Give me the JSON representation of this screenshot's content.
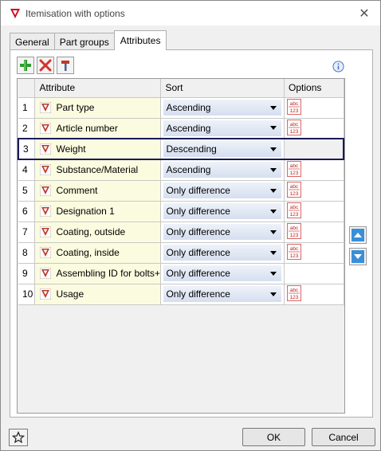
{
  "window": {
    "title": "Itemisation with options",
    "close_icon": "close-icon"
  },
  "tabs": [
    {
      "label": "General",
      "active": false
    },
    {
      "label": "Part groups",
      "active": false
    },
    {
      "label": "Attributes",
      "active": true
    }
  ],
  "toolbar": {
    "add_icon": "add-icon",
    "delete_icon": "delete-icon",
    "edit_icon": "hammer-icon",
    "info_icon": "info-icon"
  },
  "grid": {
    "columns": {
      "num": "",
      "attribute": "Attribute",
      "sort": "Sort",
      "options": "Options"
    },
    "rows": [
      {
        "num": "1",
        "attribute": "Part type",
        "sort": "Ascending",
        "has_options": true,
        "selected": false
      },
      {
        "num": "2",
        "attribute": "Article number",
        "sort": "Ascending",
        "has_options": true,
        "selected": false
      },
      {
        "num": "3",
        "attribute": "Weight",
        "sort": "Descending",
        "has_options": false,
        "selected": true
      },
      {
        "num": "4",
        "attribute": "Substance/Material",
        "sort": "Ascending",
        "has_options": true,
        "selected": false
      },
      {
        "num": "5",
        "attribute": "Comment",
        "sort": "Only difference",
        "has_options": true,
        "selected": false
      },
      {
        "num": "6",
        "attribute": "Designation 1",
        "sort": "Only difference",
        "has_options": true,
        "selected": false
      },
      {
        "num": "7",
        "attribute": "Coating, outside",
        "sort": "Only difference",
        "has_options": true,
        "selected": false
      },
      {
        "num": "8",
        "attribute": "Coating, inside",
        "sort": "Only difference",
        "has_options": true,
        "selected": false
      },
      {
        "num": "9",
        "attribute": "Assembling ID for bolts+",
        "sort": "Only difference",
        "has_options": false,
        "selected": false
      },
      {
        "num": "10",
        "attribute": "Usage",
        "sort": "Only difference",
        "has_options": true,
        "selected": false
      }
    ]
  },
  "side_buttons": {
    "up_icon": "arrow-up-icon",
    "down_icon": "arrow-down-icon"
  },
  "footer": {
    "favorite_icon": "star-icon",
    "ok_label": "OK",
    "cancel_label": "Cancel"
  },
  "colors": {
    "attribute_bg": "#fbfbe0",
    "selection_border": "#1a1a5a",
    "sort_gradient_top": "#eef2f9",
    "sort_gradient_bottom": "#d6dff0"
  }
}
